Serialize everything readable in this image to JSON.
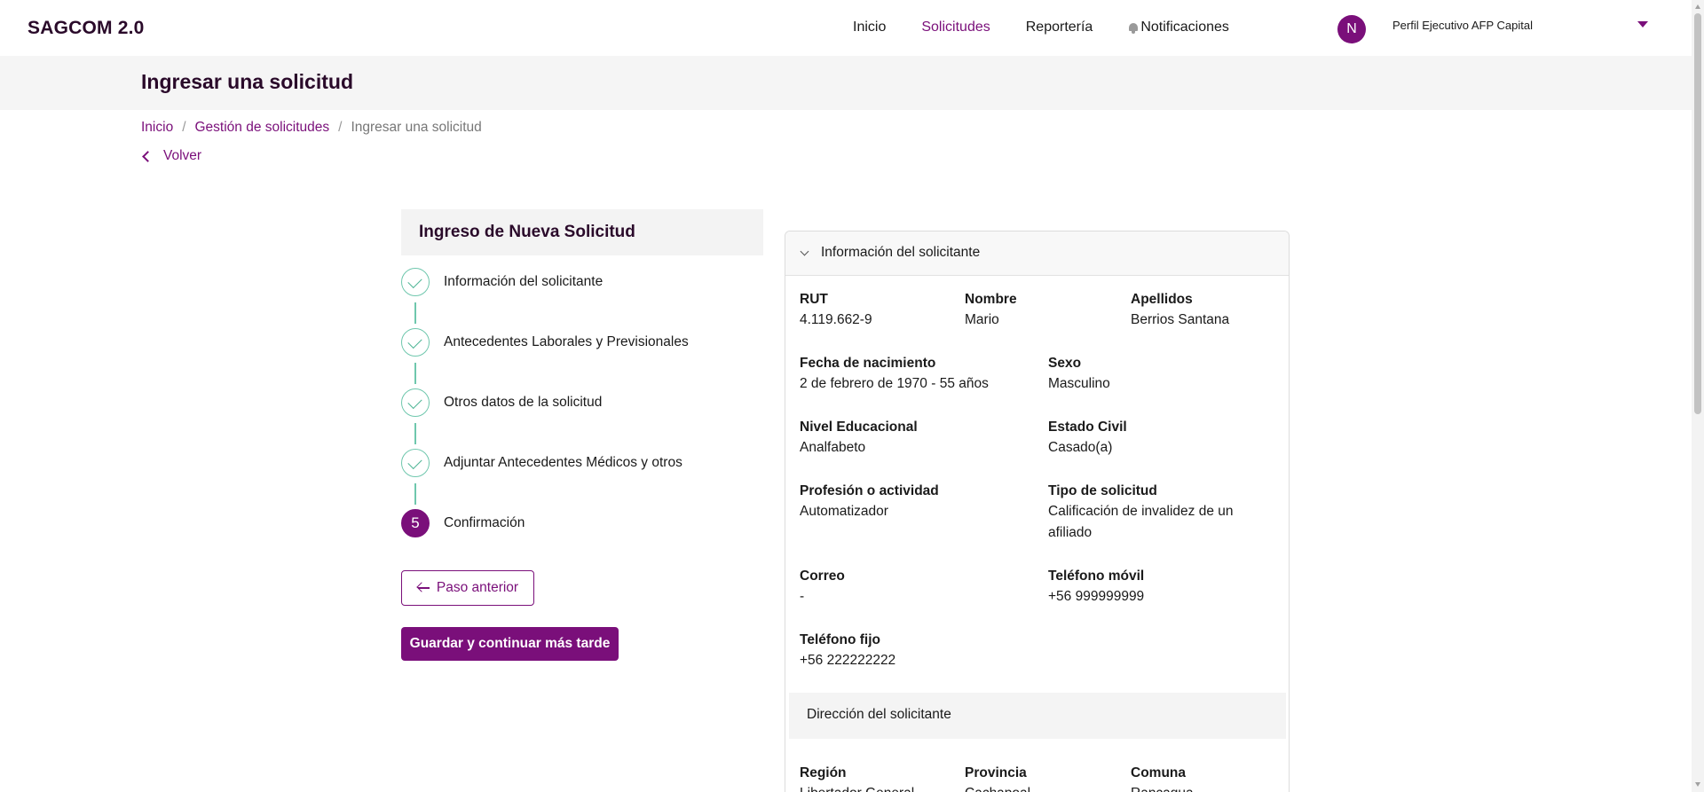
{
  "header": {
    "brand": "SAGCOM 2.0",
    "nav": [
      "Inicio",
      "Solicitudes",
      "Reportería",
      "Notificaciones"
    ],
    "active_nav": "Solicitudes",
    "avatar_initial": "N",
    "profile": "Perfil Ejecutivo AFP Capital",
    "accent_color": "#7a0f7a"
  },
  "page": {
    "title": "Ingresar una solicitud",
    "breadcrumb": [
      "Inicio",
      "Gestión de solicitudes",
      "Ingresar una solicitud"
    ],
    "back_label": "Volver"
  },
  "stepper": {
    "title": "Ingreso de Nueva Solicitud",
    "steps": [
      {
        "label": "Información del solicitante",
        "status": "done"
      },
      {
        "label": "Antecedentes Laborales y Previsionales",
        "status": "done"
      },
      {
        "label": "Otros datos de la solicitud",
        "status": "done"
      },
      {
        "label": "Adjuntar Antecedentes Médicos y otros",
        "status": "done"
      },
      {
        "label": "Confirmación",
        "status": "current",
        "number": "5"
      }
    ],
    "prev_button": "Paso anterior",
    "save_button": "Guardar y continuar más tarde"
  },
  "card": {
    "title": "Información del solicitante",
    "fields": {
      "rut": {
        "label": "RUT",
        "value": "4.119.662-9"
      },
      "nombre": {
        "label": "Nombre",
        "value": "Mario"
      },
      "apellidos": {
        "label": "Apellidos",
        "value": "Berrios Santana"
      },
      "fecha": {
        "label": "Fecha de nacimiento",
        "value": "2 de febrero de 1970 - 55 años"
      },
      "sexo": {
        "label": "Sexo",
        "value": "Masculino"
      },
      "nivel": {
        "label": "Nivel Educacional",
        "value": "Analfabeto"
      },
      "estado": {
        "label": "Estado Civil",
        "value": "Casado(a)"
      },
      "profesion": {
        "label": "Profesión o actividad",
        "value": "Automatizador"
      },
      "tipo": {
        "label": "Tipo de solicitud",
        "value": "Calificación de invalidez de un afiliado"
      },
      "correo": {
        "label": "Correo",
        "value": "-"
      },
      "movil": {
        "label": "Teléfono móvil",
        "value": "+56 999999999"
      },
      "fijo": {
        "label": "Teléfono fijo",
        "value": "+56 222222222"
      }
    },
    "address_title": "Dirección del solicitante",
    "address": {
      "region": {
        "label": "Región",
        "value": "Libertador General"
      },
      "provincia": {
        "label": "Provincia",
        "value": "Cachapoal"
      },
      "comuna": {
        "label": "Comuna",
        "value": "Rancagua"
      }
    }
  }
}
